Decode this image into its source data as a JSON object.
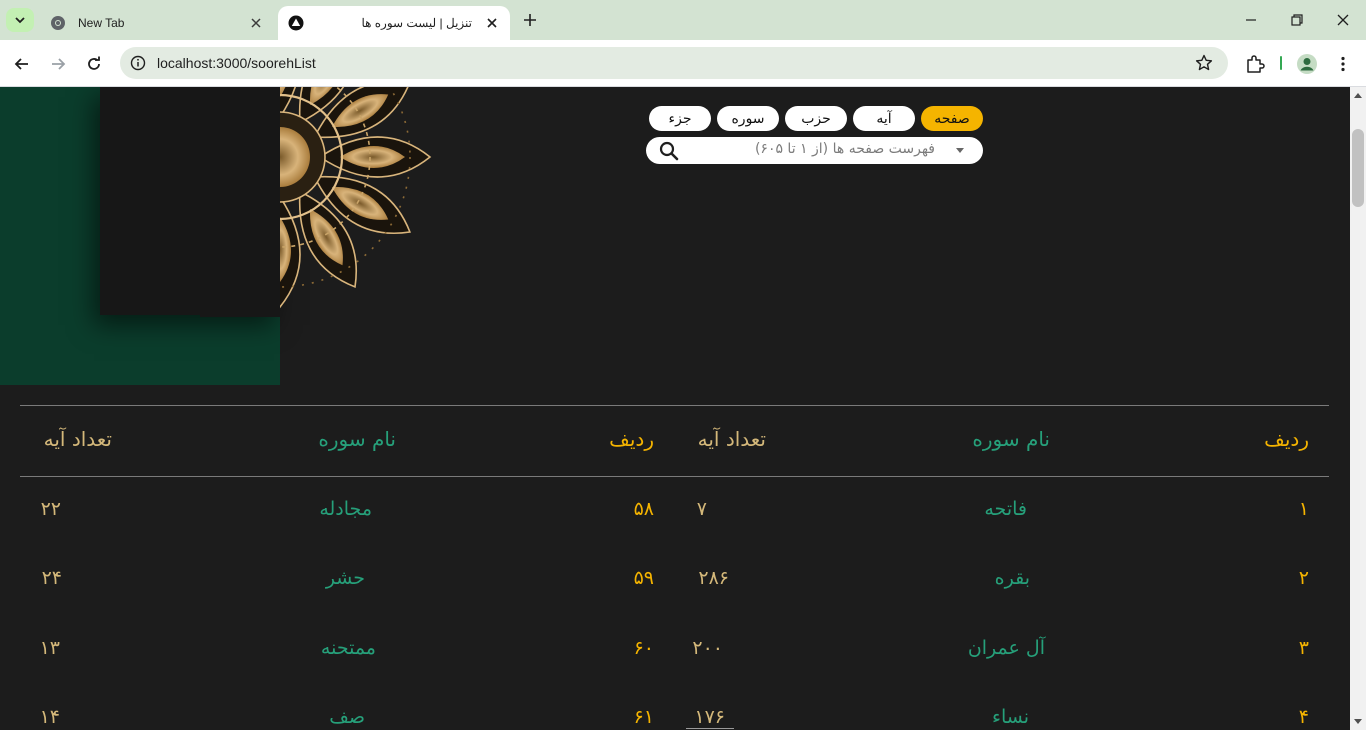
{
  "browser": {
    "tabs": [
      {
        "title": "New Tab",
        "active": false
      },
      {
        "title": "تنزیل | لیست سوره ها",
        "active": true
      }
    ],
    "url": "localhost:3000/soorehList",
    "colors": {
      "tabbar": "#d3e3d2",
      "omnibox": "#e3ebe2"
    }
  },
  "filters": {
    "tabs": [
      "صفحه",
      "آیه",
      "حزب",
      "سوره",
      "جزء"
    ],
    "active_index": 0,
    "search_placeholder": "فهرست صفحه ها (از ۱ تا ۶۰۵)"
  },
  "table": {
    "columns": [
      "ردیف",
      "نام سوره",
      "تعداد آیه"
    ],
    "left_rows": [
      {
        "index": "۵۸",
        "name": "مجادله",
        "verses": "۲۲"
      },
      {
        "index": "۵۹",
        "name": "حشر",
        "verses": "۲۴"
      },
      {
        "index": "۶۰",
        "name": "ممتحنه",
        "verses": "۱۳"
      },
      {
        "index": "۶۱",
        "name": "صف",
        "verses": "۱۴"
      }
    ],
    "right_rows": [
      {
        "index": "۱",
        "name": "فاتحه",
        "verses": "۷"
      },
      {
        "index": "۲",
        "name": "بقره",
        "verses": "۲۸۶"
      },
      {
        "index": "۳",
        "name": "آل عمران",
        "verses": "۲۰۰"
      },
      {
        "index": "۴",
        "name": "نساء",
        "verses": "۱۷۶"
      }
    ]
  },
  "colors": {
    "background": "#1c1c1c",
    "accent_yellow": "#f5b400",
    "accent_green": "#26a07a",
    "accent_tan": "#d4b87a",
    "panel_green": "#0b3d2c"
  }
}
